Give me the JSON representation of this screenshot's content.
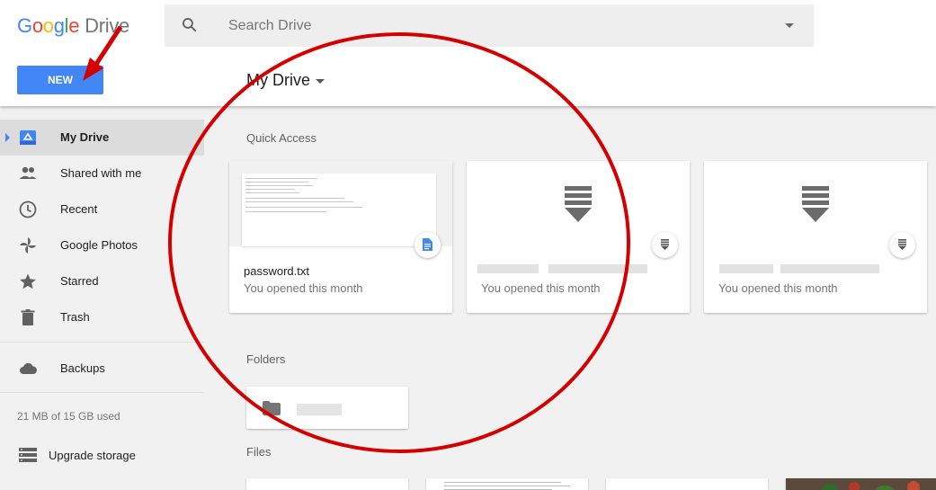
{
  "app": {
    "logo_brand_letters": [
      "G",
      "o",
      "o",
      "g",
      "l",
      "e"
    ],
    "logo_product": "Drive"
  },
  "search": {
    "placeholder": "Search Drive",
    "icon": "search-icon"
  },
  "new_button": {
    "label": "NEW"
  },
  "breadcrumb": {
    "label": "My Drive"
  },
  "sidebar": {
    "items": [
      {
        "label": "My Drive",
        "icon": "my-drive-icon",
        "active": true
      },
      {
        "label": "Shared with me",
        "icon": "people-icon"
      },
      {
        "label": "Recent",
        "icon": "clock-icon"
      },
      {
        "label": "Google Photos",
        "icon": "pinwheel-icon"
      },
      {
        "label": "Starred",
        "icon": "star-icon"
      },
      {
        "label": "Trash",
        "icon": "trash-icon"
      },
      {
        "label": "Backups",
        "icon": "cloud-icon"
      }
    ],
    "storage": "21 MB of 15 GB used",
    "upgrade": {
      "label": "Upgrade storage",
      "icon": "storage-icon"
    }
  },
  "main": {
    "quick_access": {
      "title": "Quick Access",
      "cards": [
        {
          "name": "password.txt",
          "subtitle": "You opened this month",
          "type_icon": "google-doc-icon"
        },
        {
          "name": "",
          "subtitle": "You opened this month",
          "type_icon": "download-file-icon",
          "name_blurred": true
        },
        {
          "name": "",
          "subtitle": "You opened this month",
          "type_icon": "download-file-icon",
          "name_blurred": true
        }
      ]
    },
    "folders": {
      "title": "Folders",
      "items": [
        {
          "name": "",
          "name_blurred": true
        }
      ]
    },
    "files": {
      "title": "Files"
    }
  },
  "colors": {
    "accent_blue": "#4285f4",
    "annotation_red": "#d40000",
    "sidebar_active_bg": "#dcdcdc",
    "icon_gray": "#616161"
  }
}
